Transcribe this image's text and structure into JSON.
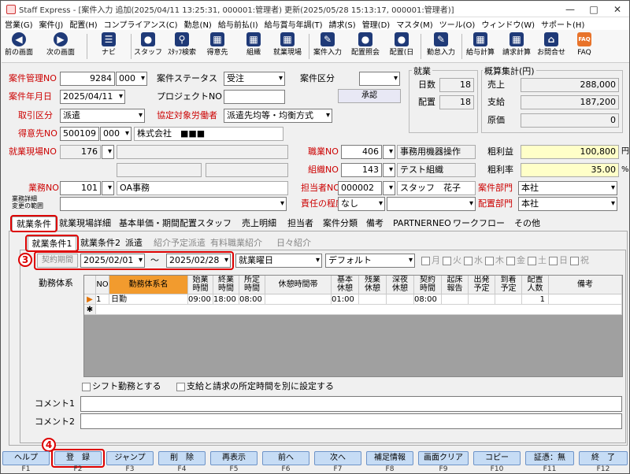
{
  "window": {
    "title": "Staff Express - [案件入力 追加(2025/04/11 13:25:31, 000001:管理者) 更新(2025/05/28 15:13:17, 000001:管理者)]",
    "min": "—",
    "max": "□",
    "close": "✕"
  },
  "menu": [
    "営業(G)",
    "案件(J)",
    "配置(H)",
    "コンプライアンス(C)",
    "勤怠(N)",
    "給与前払(I)",
    "給与賞与年調(T)",
    "請求(S)",
    "管理(D)",
    "マスタ(M)",
    "ツール(O)",
    "ウィンドウ(W)",
    "サポート(H)"
  ],
  "toolbar": {
    "prev": "前の画面",
    "next": "次の画面",
    "navi": "ナビ",
    "staff": "スタッフ",
    "staff_search": "ｽﾀｯﾌ検索",
    "client": "得意先",
    "org": "組織",
    "site": "就業現場",
    "job_input": "案件入力",
    "assign_view": "配置照会",
    "assign_day": "配置(日",
    "attend_input": "勤怠入力",
    "payroll": "給与計算",
    "billing": "請求計算",
    "contact": "お問合せ",
    "faq": "FAQ",
    "faq_icon": "FAQ"
  },
  "form": {
    "job_no_label": "案件管理NO",
    "job_no": "9284",
    "job_no_sub": "000",
    "job_status_label": "案件ステータス",
    "job_status": "受注",
    "job_type_label": "案件区分",
    "job_type": "",
    "job_date_label": "案件年月日",
    "job_date": "2025/04/11",
    "project_label": "プロジェクトNO",
    "project": "",
    "approve_button": "承認",
    "deal_type_label": "取引区分",
    "deal_type": "派遣",
    "labor_label": "協定対象労働者",
    "labor": "派遣先均等・均衡方式",
    "client_label": "得意先NO",
    "client_no": "500109",
    "client_sub": "000",
    "client_name": "株式会社　■■■",
    "site_label": "就業現場NO",
    "site_no": "176",
    "occupation_label": "職業NO",
    "occupation_no": "406",
    "occupation_name": "事務用機器操作",
    "org_label": "組織NO",
    "org_no": "143",
    "org_name": "テスト組織",
    "work_label": "業務NO",
    "work_no": "101",
    "work_name": "OA事務",
    "owner_label": "担当者NO",
    "owner_no": "000002",
    "owner_name": "スタッフ　花子",
    "dept_label": "案件部門",
    "dept": "本社",
    "scope_label": "業務詳細\n変更の範囲",
    "scope": "",
    "resp_label": "責任の程度",
    "resp": "なし",
    "assign_dept_label": "配置部門",
    "assign_dept": "本社"
  },
  "work_summary": {
    "title": "就業",
    "days_label": "日数",
    "days": "18",
    "assigned_label": "配置",
    "assigned": "18"
  },
  "estimate": {
    "title": "概算集計(円)",
    "sales_label": "売上",
    "sales": "288,000",
    "pay_label": "支給",
    "pay": "187,200",
    "cost_label": "原価",
    "cost": "0",
    "gross_label": "粗利益",
    "gross": "100,800",
    "gross_unit": "円",
    "rate_label": "粗利率",
    "rate": "35.00",
    "rate_unit": "%"
  },
  "tabs": [
    "就業条件",
    "就業現場詳細",
    "基本単価・期間配置スタッフ",
    "売上明細",
    "担当者",
    "案件分類",
    "備考",
    "PARTNER",
    "NEO",
    "ワークフロー",
    "その他"
  ],
  "subtabs": [
    "就業条件1",
    "就業条件2",
    "派遣",
    "紹介予定派遣",
    "有料職業紹介",
    "日々紹介"
  ],
  "period": {
    "label": "契約期間",
    "from": "2025/02/01",
    "tilde": "～",
    "to": "2025/02/28",
    "weekday": "就業曜日",
    "pattern": "デフォルト",
    "days": [
      "月",
      "火",
      "水",
      "木",
      "金",
      "土",
      "日",
      "祝"
    ]
  },
  "grid": {
    "label": "勤務体系",
    "headers": [
      "NO",
      "勤務体系名",
      "始業\n時間",
      "終業\n時間",
      "所定\n時間",
      "休憩時間帯",
      "基本\n休憩",
      "残業\n休憩",
      "深夜\n休憩",
      "契約\n時間",
      "起床\n報告",
      "出発\n予定",
      "到着\n予定",
      "配置\n人数",
      "備考"
    ],
    "row": {
      "no": "1",
      "name": "日勤",
      "start": "09:00",
      "end": "18:00",
      "regular": "08:00",
      "break_range": "",
      "basic_break": "01:00",
      "ot_break": "",
      "night_break": "",
      "contract": "08:00",
      "wake": "",
      "depart": "",
      "arrive": "",
      "count": "1",
      "note": ""
    },
    "new_row_marker": "✱",
    "current_marker": "▶"
  },
  "options": {
    "shift": "シフト勤務とする",
    "separate": "支給と請求の所定時間を別に設定する"
  },
  "comments": {
    "c1_label": "コメント1",
    "c1": "",
    "c2_label": "コメント2",
    "c2": ""
  },
  "callouts": {
    "three": "3",
    "four": "4"
  },
  "fkeys": [
    {
      "label": "ヘルプ",
      "key": "F1"
    },
    {
      "label": "登　録",
      "key": "F2"
    },
    {
      "label": "ジャンプ",
      "key": "F3"
    },
    {
      "label": "削　除",
      "key": "F4"
    },
    {
      "label": "再表示",
      "key": "F5"
    },
    {
      "label": "前へ",
      "key": "F6"
    },
    {
      "label": "次へ",
      "key": "F7"
    },
    {
      "label": "補足情報",
      "key": "F8"
    },
    {
      "label": "画面クリア",
      "key": "F9"
    },
    {
      "label": "コピー",
      "key": "F10"
    },
    {
      "label": "証憑：無",
      "key": "F11"
    },
    {
      "label": "終　了",
      "key": "F12"
    }
  ]
}
